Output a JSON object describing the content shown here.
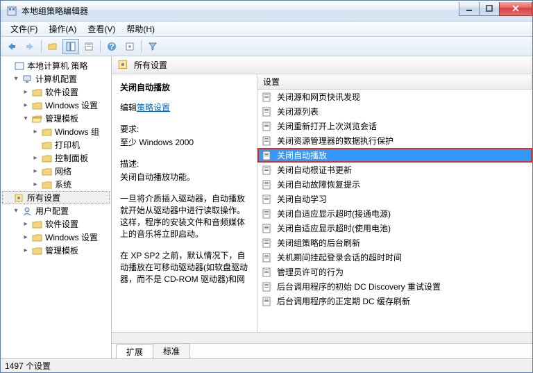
{
  "window": {
    "title": "本地组策略编辑器"
  },
  "menu": {
    "file": "文件(F)",
    "action": "操作(A)",
    "view": "查看(V)",
    "help": "帮助(H)"
  },
  "tree": {
    "root": "本地计算机 策略",
    "computer": "计算机配置",
    "cSoft": "软件设置",
    "cWin": "Windows 设置",
    "cAdmin": "管理模板",
    "cWinComp": "Windows 组",
    "cPrinter": "打印机",
    "cControl": "控制面板",
    "cNetwork": "网络",
    "cSystem": "系统",
    "cAll": "所有设置",
    "user": "用户配置",
    "uSoft": "软件设置",
    "uWin": "Windows 设置",
    "uAdmin": "管理模板"
  },
  "header": {
    "title": "所有设置"
  },
  "detail": {
    "title": "关闭自动播放",
    "editPrefix": "编辑",
    "editLink": "策略设置",
    "reqLabel": "要求:",
    "reqValue": "至少 Windows 2000",
    "descLabel": "描述:",
    "desc1": "关闭自动播放功能。",
    "desc2": "一旦将介质插入驱动器，自动播放就开始从驱动器中进行读取操作。这样，程序的安装文件和音频媒体上的音乐将立即启动。",
    "desc3": "在 XP SP2 之前，默认情况下，自动播放在可移动驱动器(如软盘驱动器，而不是 CD-ROM 驱动器)和网"
  },
  "list": {
    "column": "设置",
    "items": [
      "关闭源和网页快讯发现",
      "关闭源列表",
      "关闭重新打开上次浏览会话",
      "关闭资源管理器的数据执行保护",
      "关闭自动播放",
      "关闭自动根证书更新",
      "关闭自动故障恢复提示",
      "关闭自动学习",
      "关闭自适应显示超时(接通电源)",
      "关闭自适应显示超时(使用电池)",
      "关闭组策略的后台刷新",
      "关机期间挂起登录会话的超时时间",
      "管理员许可的行为",
      "后台调用程序的初始 DC Discovery 重试设置",
      "后台调用程序的正定期 DC 缓存刷新"
    ],
    "selectedIndex": 4
  },
  "tabs": {
    "ext": "扩展",
    "std": "标准"
  },
  "status": {
    "text": "1497 个设置"
  }
}
